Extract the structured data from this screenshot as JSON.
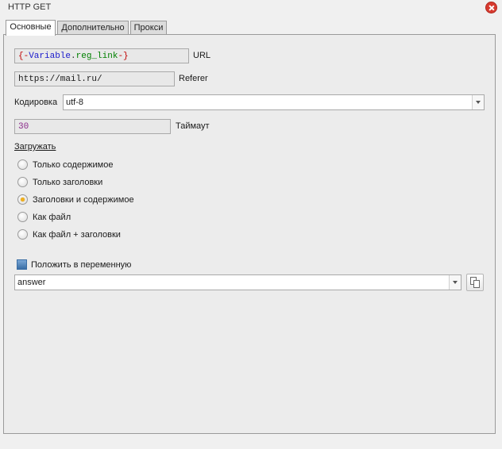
{
  "window": {
    "title": "HTTP GET"
  },
  "tabs": [
    {
      "label": "Основные",
      "active": true
    },
    {
      "label": "Дополнительно",
      "active": false
    },
    {
      "label": "Прокси",
      "active": false
    }
  ],
  "form": {
    "url": {
      "value_parts": {
        "open": "{-",
        "var": "Variable",
        "dot": ".",
        "prop": "reg_link",
        "close": "-}"
      },
      "label": "URL"
    },
    "referer": {
      "value": "https://mail.ru/",
      "label": "Referer"
    },
    "encoding": {
      "label": "Кодировка",
      "value": "utf-8"
    },
    "timeout": {
      "value": "30",
      "label": "Таймаут"
    },
    "load": {
      "label": "Загружать",
      "options": [
        {
          "label": "Только содержимое",
          "checked": false
        },
        {
          "label": "Только заголовки",
          "checked": false
        },
        {
          "label": "Заголовки и содержимое",
          "checked": true
        },
        {
          "label": "Как файл",
          "checked": false
        },
        {
          "label": "Как файл + заголовки",
          "checked": false
        }
      ]
    },
    "save_to_variable": {
      "label": "Положить в переменную",
      "value": "answer"
    }
  },
  "colors": {
    "close": "#d73a2f",
    "radio_checked": "#f0b020",
    "var_brace": "#c00000",
    "var_name": "#1a1acc",
    "var_prop": "#008000",
    "timeout_text": "#8a2b8a"
  }
}
